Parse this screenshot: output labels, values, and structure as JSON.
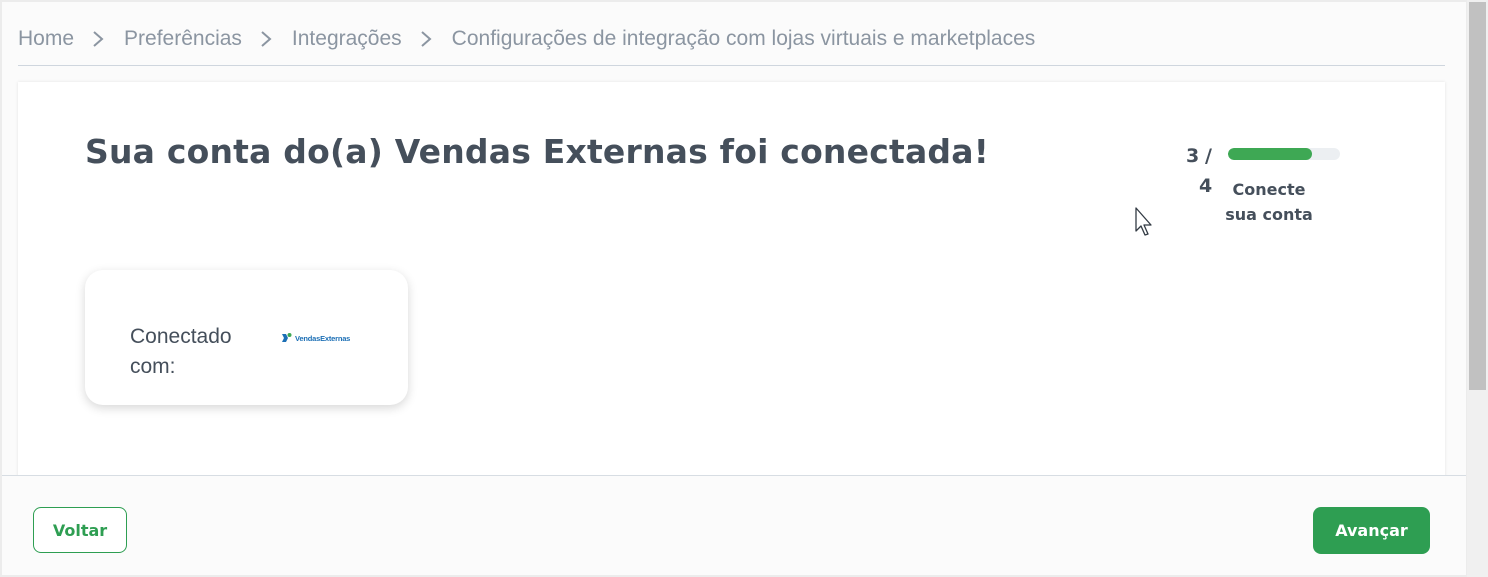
{
  "breadcrumb": {
    "items": [
      {
        "label": "Home"
      },
      {
        "label": "Preferências"
      },
      {
        "label": "Integrações"
      },
      {
        "label": "Configurações de integração com lojas virtuais e marketplaces"
      }
    ]
  },
  "main": {
    "title": "Sua conta do(a) Vendas Externas foi conectada!",
    "step": {
      "current": "3",
      "separator": "/",
      "total": "4",
      "label": "Conecte sua conta",
      "progress_percent": 75
    },
    "connection": {
      "label": "Conectado com:",
      "logo_text": "VendasExternas"
    }
  },
  "footer": {
    "back_label": "Voltar",
    "next_label": "Avançar"
  },
  "colors": {
    "accent": "#2e9e52",
    "progress": "#3ea854",
    "text": "#454f5b",
    "breadcrumb": "#8b95a1",
    "logo": "#1c6fb5"
  },
  "icons": {
    "breadcrumb_separator": "chevron-right-icon",
    "logo": "vendas-externas-logo",
    "cursor": "mouse-pointer-icon"
  }
}
